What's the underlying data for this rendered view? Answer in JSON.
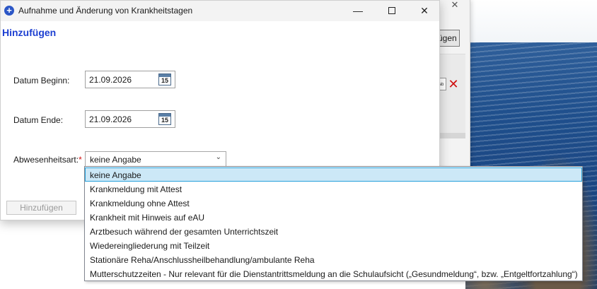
{
  "window": {
    "title": "Aufnahme und Änderung von Krankheitstagen",
    "minimize": "—",
    "close": "✕"
  },
  "heading": "Hinzufügen",
  "form": {
    "start_label": "Datum Beginn:",
    "start_value": "21.09.2026",
    "end_label": "Datum Ende:",
    "end_value": "21.09.2026",
    "calendar_day": "15",
    "absence_label": "Abwesenheitsart:",
    "absence_required": "*",
    "absence_value": "keine Angabe",
    "submit_label": "Hinzufügen"
  },
  "dropdown": {
    "selected_index": 0,
    "options": [
      "keine Angabe",
      "Krankmeldung mit Attest",
      "Krankmeldung ohne Attest",
      "Krankheit mit Hinweis auf eAU",
      "Arztbesuch während der gesamten Unterrichtszeit",
      "Wiedereingliederung mit Teilzeit",
      "Stationäre Reha/Anschlussheilbehandlung/ambulante Reha",
      "Mutterschutzzeiten - Nur relevant für die Dienstantrittsmeldung an die Schulaufsicht („Gesundmeldung“, bzw. „Entgeltfortzahlung“)"
    ]
  },
  "background_window": {
    "close": "✕",
    "button_label": "ügen",
    "icon_ab": "ab",
    "icon_x": "✕"
  }
}
